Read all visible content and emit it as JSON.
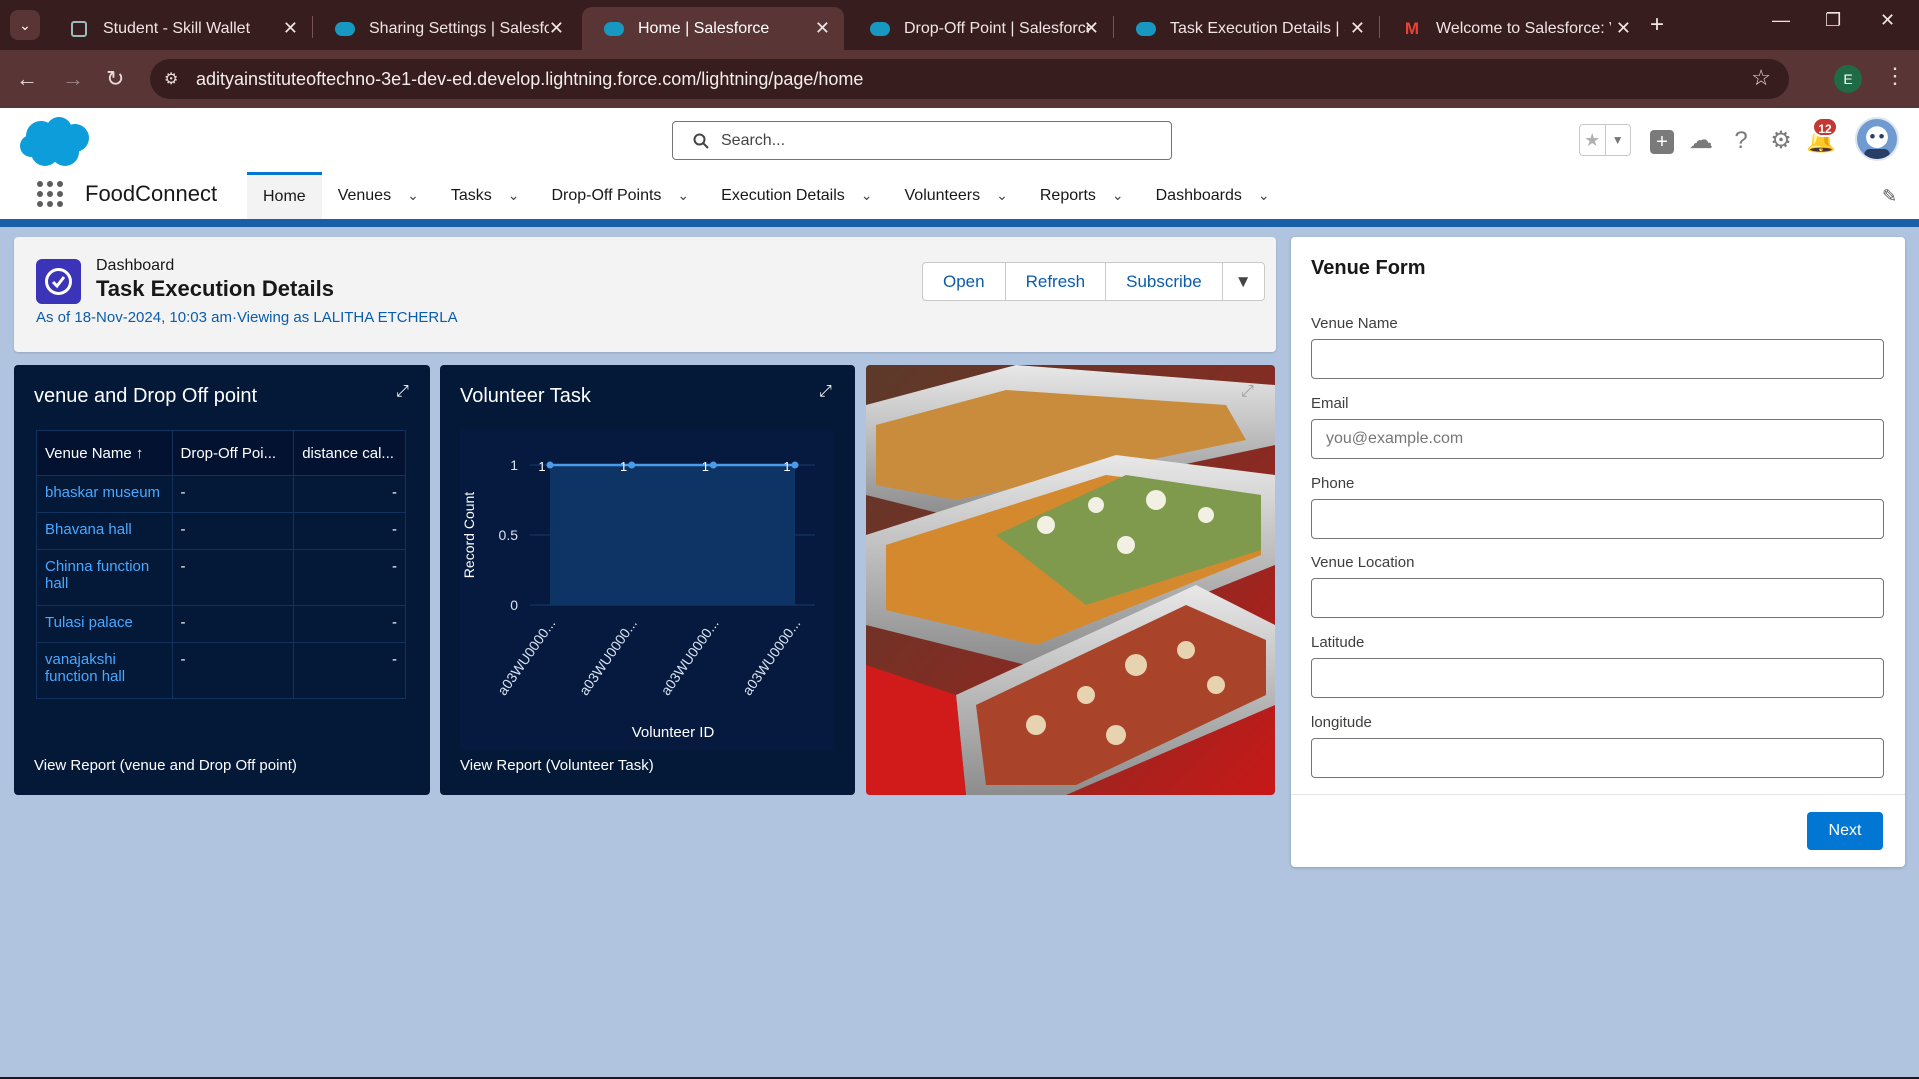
{
  "browser": {
    "tabs": [
      {
        "label": "Student - Skill Wallet",
        "icon": "page-icon"
      },
      {
        "label": "Sharing Settings | Salesforce",
        "icon": "salesforce-cloud-icon"
      },
      {
        "label": "Home | Salesforce",
        "icon": "salesforce-cloud-icon",
        "active": true
      },
      {
        "label": "Drop-Off Point | Salesforce",
        "icon": "salesforce-cloud-icon"
      },
      {
        "label": "Task Execution Details | Salesforce",
        "icon": "salesforce-cloud-icon"
      },
      {
        "label": "Welcome to Salesforce: Verify",
        "icon": "gmail-icon"
      }
    ],
    "url": "adityainstituteoftechno-3e1-dev-ed.develop.lightning.force.com/lightning/page/home",
    "profile_initial": "E"
  },
  "header": {
    "search_placeholder": "Search...",
    "notifications_count": "12",
    "app_name": "FoodConnect",
    "nav": [
      {
        "label": "Home",
        "active": true
      },
      {
        "label": "Venues"
      },
      {
        "label": "Tasks"
      },
      {
        "label": "Drop-Off Points"
      },
      {
        "label": "Execution Details"
      },
      {
        "label": "Volunteers"
      },
      {
        "label": "Reports"
      },
      {
        "label": "Dashboards"
      }
    ]
  },
  "dashboard": {
    "kicker": "Dashboard",
    "title": "Task Execution Details",
    "meta": "As of 18-Nov-2024, 10:03 am·Viewing as LALITHA ETCHERLA",
    "buttons": {
      "open": "Open",
      "refresh": "Refresh",
      "subscribe": "Subscribe",
      "more": "▼"
    }
  },
  "widget_venue": {
    "title": "venue and Drop Off point",
    "columns": [
      "Venue Name ↑",
      "Drop-Off Poi...",
      "distance cal..."
    ],
    "rows": [
      [
        "bhaskar museum",
        "-",
        "-"
      ],
      [
        "Bhavana hall",
        "-",
        "-"
      ],
      [
        "Chinna function hall",
        "-",
        "-"
      ],
      [
        "Tulasi palace",
        "-",
        "-"
      ],
      [
        "vanajakshi function hall",
        "-",
        "-"
      ]
    ],
    "report_link": "View Report (venue and Drop Off point)"
  },
  "widget_volunteer": {
    "title": "Volunteer Task",
    "report_link": "View Report (Volunteer Task)"
  },
  "chart_data": {
    "type": "line",
    "categories": [
      "a03WU0000...",
      "a03WU0000...",
      "a03WU0000...",
      "a03WU0000..."
    ],
    "values": [
      1,
      1,
      1,
      1
    ],
    "data_labels": [
      "1",
      "1",
      "1",
      "1"
    ],
    "xlabel": "Volunteer ID",
    "ylabel": "Record Count",
    "ylim": [
      0,
      1
    ],
    "yticks": [
      "0",
      "0.5",
      "1"
    ],
    "color": "#4a9be8"
  },
  "venue_form": {
    "title": "Venue Form",
    "fields": [
      {
        "label": "Venue Name",
        "placeholder": ""
      },
      {
        "label": "Email",
        "placeholder": "you@example.com"
      },
      {
        "label": "Phone",
        "placeholder": ""
      },
      {
        "label": "Venue Location",
        "placeholder": ""
      },
      {
        "label": "Latitude",
        "placeholder": ""
      },
      {
        "label": "longitude",
        "placeholder": ""
      }
    ],
    "next_label": "Next"
  }
}
